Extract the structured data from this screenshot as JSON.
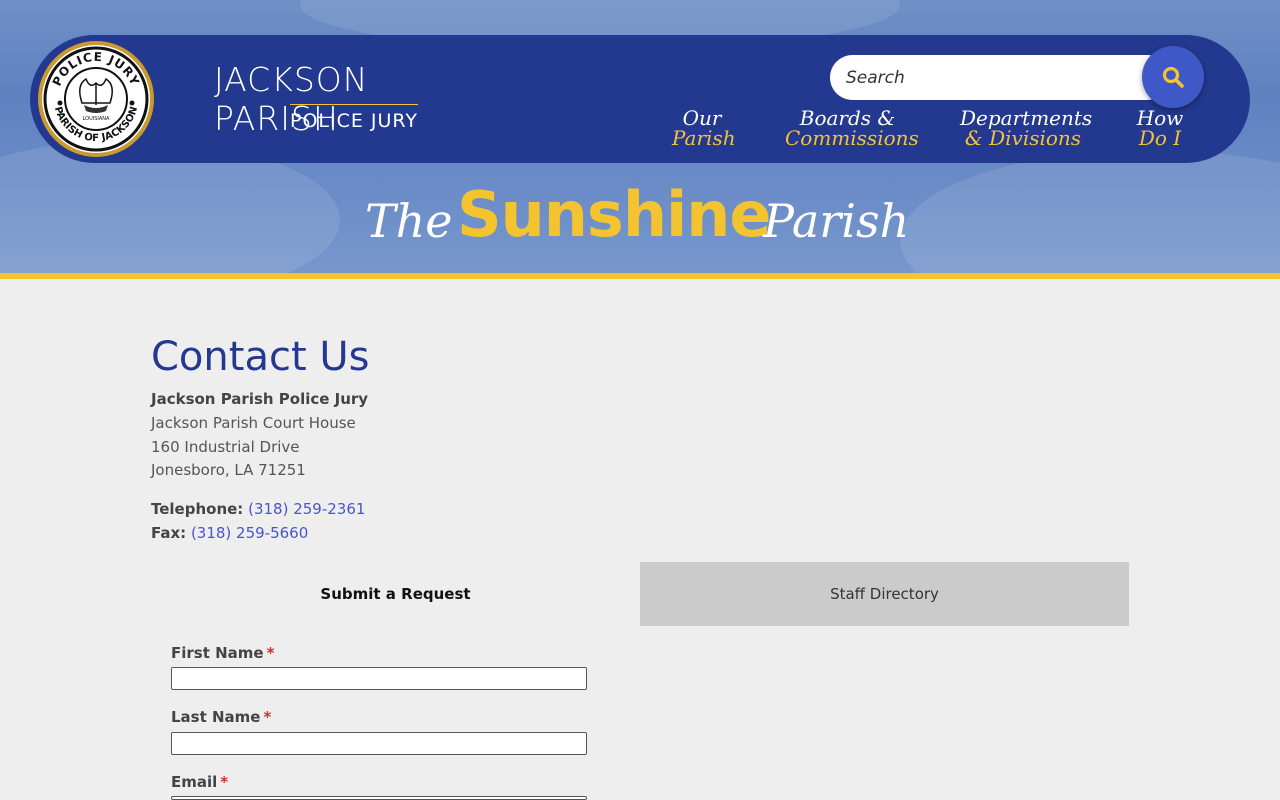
{
  "header": {
    "seal_text_top": "POLICE JURY",
    "seal_text_bottom": "PARISH OF JACKSON",
    "seal_text_center": "LOUISIANA",
    "site_title": "JACKSON PARISH",
    "site_subtitle": "POLICE JURY",
    "search": {
      "placeholder": "Search"
    },
    "nav": [
      {
        "line1": "Our",
        "line2": "Parish"
      },
      {
        "line1": "Boards &",
        "line2": "Commissions"
      },
      {
        "line1": "Departments",
        "line2": "& Divisions"
      },
      {
        "line1": "How",
        "line2": "Do I"
      }
    ],
    "tagline": {
      "the": "The",
      "sunshine": "Sunshine",
      "parish": "Parish"
    }
  },
  "colors": {
    "brand_blue": "#23388f",
    "gold": "#f4c430",
    "link": "#4a55c9",
    "required": "#d32b2b"
  },
  "main": {
    "title": "Contact Us",
    "org_name": "Jackson Parish Police Jury",
    "address": [
      "Jackson Parish Court House",
      "160 Industrial Drive",
      "Jonesboro, LA 71251"
    ],
    "telephone": {
      "label": "Telephone:",
      "value": "(318) 259-2361"
    },
    "fax": {
      "label": "Fax:",
      "value": "(318) 259-5660"
    },
    "tabs": [
      {
        "label": "Submit a Request",
        "active": true
      },
      {
        "label": "Staff Directory",
        "active": false
      }
    ],
    "form": {
      "fields": [
        {
          "label": "First Name",
          "required_mark": "*",
          "value": ""
        },
        {
          "label": "Last Name",
          "required_mark": "*",
          "value": ""
        },
        {
          "label": "Email",
          "required_mark": "*",
          "value": ""
        }
      ]
    }
  }
}
